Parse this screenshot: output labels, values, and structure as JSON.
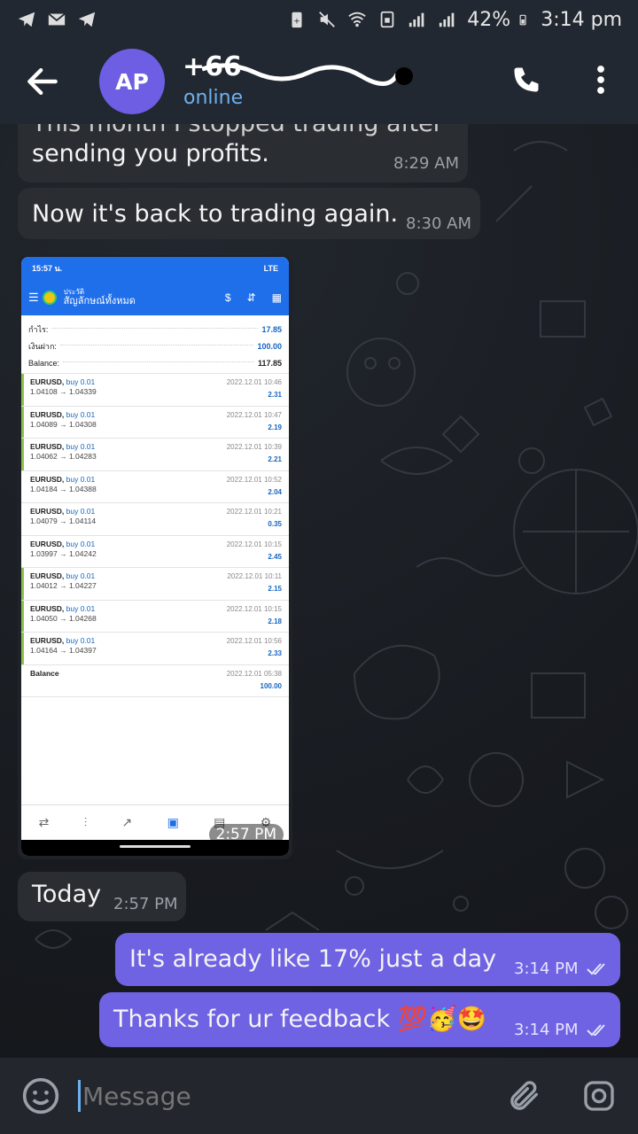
{
  "status_bar": {
    "battery": "42%",
    "time": "3:14 pm"
  },
  "header": {
    "avatar_initials": "AP",
    "contact_name": "+66",
    "contact_status": "online"
  },
  "messages": [
    {
      "direction": "in",
      "text": "sending you profits.",
      "partial_above": "This month I stopped trading after",
      "time": "8:29 AM"
    },
    {
      "direction": "in",
      "text": "Now it's back to trading again.",
      "time": "8:30 AM"
    },
    {
      "direction": "in",
      "type": "image",
      "time": "2:57 PM"
    },
    {
      "direction": "in",
      "text": "Today",
      "time": "2:57 PM"
    },
    {
      "direction": "out",
      "text": "It's already like 17% just a day",
      "time": "3:14 PM"
    },
    {
      "direction": "out",
      "text": "Thanks for ur feedback 💯🥳🤩",
      "time": "3:14 PM"
    }
  ],
  "screenshot": {
    "status_time": "15:57 น.",
    "status_right": "LTE",
    "title_small": "ประวัติ",
    "title_big": "สัญลักษณ์ทั้งหมด",
    "summary": [
      {
        "label": "กำไร:",
        "value": "17.85"
      },
      {
        "label": "เงินฝาก:",
        "value": "100.00"
      },
      {
        "label": "Balance:",
        "value": "117.85"
      }
    ],
    "trades": [
      {
        "symbol": "EURUSD,",
        "dir": "buy 0.01",
        "prices": "1.04108 → 1.04339",
        "date": "2022.12.01 10:46",
        "profit": "2.31",
        "green": true
      },
      {
        "symbol": "EURUSD,",
        "dir": "buy 0.01",
        "prices": "1.04089 → 1.04308",
        "date": "2022.12.01 10:47",
        "profit": "2.19",
        "green": true
      },
      {
        "symbol": "EURUSD,",
        "dir": "buy 0.01",
        "prices": "1.04062 → 1.04283",
        "date": "2022.12.01 10:39",
        "profit": "2.21",
        "green": true
      },
      {
        "symbol": "EURUSD,",
        "dir": "buy 0.01",
        "prices": "1.04184 → 1.04388",
        "date": "2022.12.01 10:52",
        "profit": "2.04",
        "green": false
      },
      {
        "symbol": "EURUSD,",
        "dir": "buy 0.01",
        "prices": "1.04079 → 1.04114",
        "date": "2022.12.01 10:21",
        "profit": "0.35",
        "green": false
      },
      {
        "symbol": "EURUSD,",
        "dir": "buy 0.01",
        "prices": "1.03997 → 1.04242",
        "date": "2022.12.01 10:15",
        "profit": "2.45",
        "green": false
      },
      {
        "symbol": "EURUSD,",
        "dir": "buy 0.01",
        "prices": "1.04012 → 1.04227",
        "date": "2022.12.01 10:11",
        "profit": "2.15",
        "green": true
      },
      {
        "symbol": "EURUSD,",
        "dir": "buy 0.01",
        "prices": "1.04050 → 1.04268",
        "date": "2022.12.01 10:15",
        "profit": "2.18",
        "green": true
      },
      {
        "symbol": "EURUSD,",
        "dir": "buy 0.01",
        "prices": "1.04164 → 1.04397",
        "date": "2022.12.01 10:56",
        "profit": "2.33",
        "green": true
      },
      {
        "symbol": "Balance",
        "dir": "",
        "prices": "",
        "date": "2022.12.01 05:38",
        "profit": "100.00",
        "green": false
      }
    ]
  },
  "input": {
    "placeholder": "Message"
  },
  "colors": {
    "outgoing_bubble": "#6f62e3",
    "incoming_bubble": "#2a2e33",
    "header_bg": "#222831",
    "accent": "#6db1ef",
    "avatar": "#6d5ee3"
  },
  "icons": [
    "back-arrow-icon",
    "phone-icon",
    "more-vertical-icon",
    "emoji-icon",
    "attach-icon",
    "camera-icon",
    "double-check-icon"
  ]
}
